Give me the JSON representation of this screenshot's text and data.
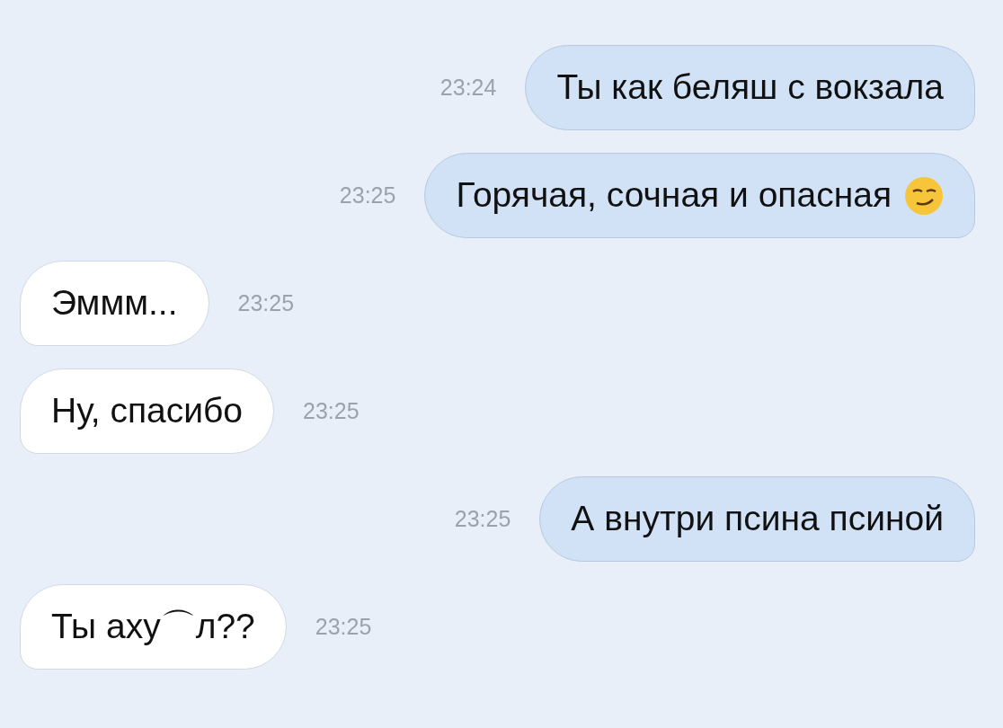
{
  "messages": [
    {
      "kind": "outgoing",
      "text": "Ты как беляш с вокзала",
      "time": "23:24"
    },
    {
      "kind": "outgoing",
      "text": "Горячая, сочная и опасная",
      "time": "23:25",
      "smiley": true
    },
    {
      "kind": "incoming",
      "text": "Эммм...",
      "time": "23:25"
    },
    {
      "kind": "incoming",
      "text": "Ну, спасибо",
      "time": "23:25"
    },
    {
      "kind": "outgoing",
      "text": "А внутри псина псиной",
      "time": "23:25"
    },
    {
      "kind": "incoming",
      "text": "Ты аху⌒л??",
      "time": "23:25"
    }
  ]
}
